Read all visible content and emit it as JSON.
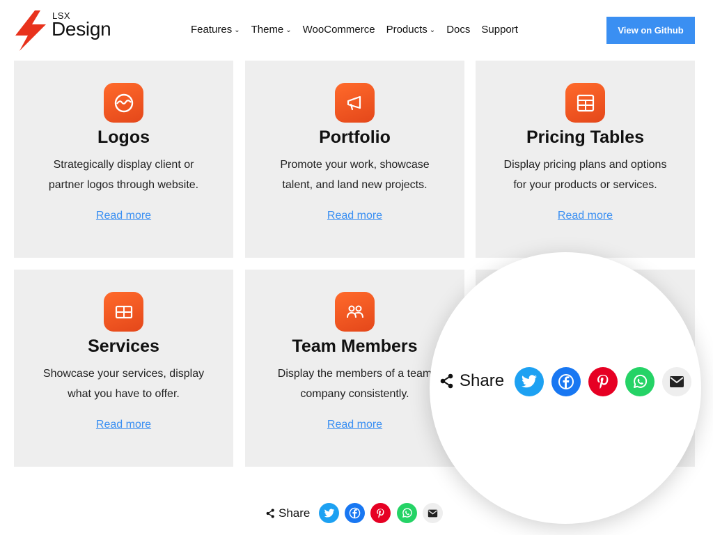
{
  "brand": {
    "small": "LSX",
    "big": "Design",
    "accent": "#e8321c"
  },
  "nav": {
    "items": [
      {
        "label": "Features",
        "chevron": "⌄"
      },
      {
        "label": "Theme",
        "chevron": "⌄"
      },
      {
        "label": "WooCommerce",
        "chevron": ""
      },
      {
        "label": "Products",
        "chevron": "⌄"
      },
      {
        "label": "Docs",
        "chevron": ""
      },
      {
        "label": "Support",
        "chevron": ""
      }
    ],
    "cta_label": "View on Github",
    "cta_color": "#3a8ff2"
  },
  "cards": [
    {
      "icon": "logos-icon",
      "title": "Logos",
      "desc": "Strategically display client or partner logos through website.",
      "link": "Read more"
    },
    {
      "icon": "megaphone-icon",
      "title": "Portfolio",
      "desc": "Promote your work, showcase talent, and land new projects.",
      "link": "Read more"
    },
    {
      "icon": "table-icon",
      "title": "Pricing Tables",
      "desc": "Display pricing plans and options for your products or services.",
      "link": "Read more"
    },
    {
      "icon": "grid-icon",
      "title": "Services",
      "desc": "Showcase your services, display what you have to offer.",
      "link": "Read more"
    },
    {
      "icon": "users-icon",
      "title": "Team Members",
      "desc": "Display the members of a team company consistently.",
      "link": "Read more"
    }
  ],
  "share": {
    "label": "Share",
    "networks": [
      {
        "name": "twitter-icon",
        "color": "#1da1f2"
      },
      {
        "name": "facebook-icon",
        "color": "#1877f2"
      },
      {
        "name": "pinterest-icon",
        "color": "#e60023"
      },
      {
        "name": "whatsapp-icon",
        "color": "#25d366"
      },
      {
        "name": "email-icon",
        "color": "#eeeeee"
      }
    ]
  },
  "colors": {
    "card_bg": "#eeeeee",
    "icon_gradient_start": "#ff6a2b",
    "icon_gradient_end": "#e4471a",
    "link": "#3a8ff2"
  }
}
